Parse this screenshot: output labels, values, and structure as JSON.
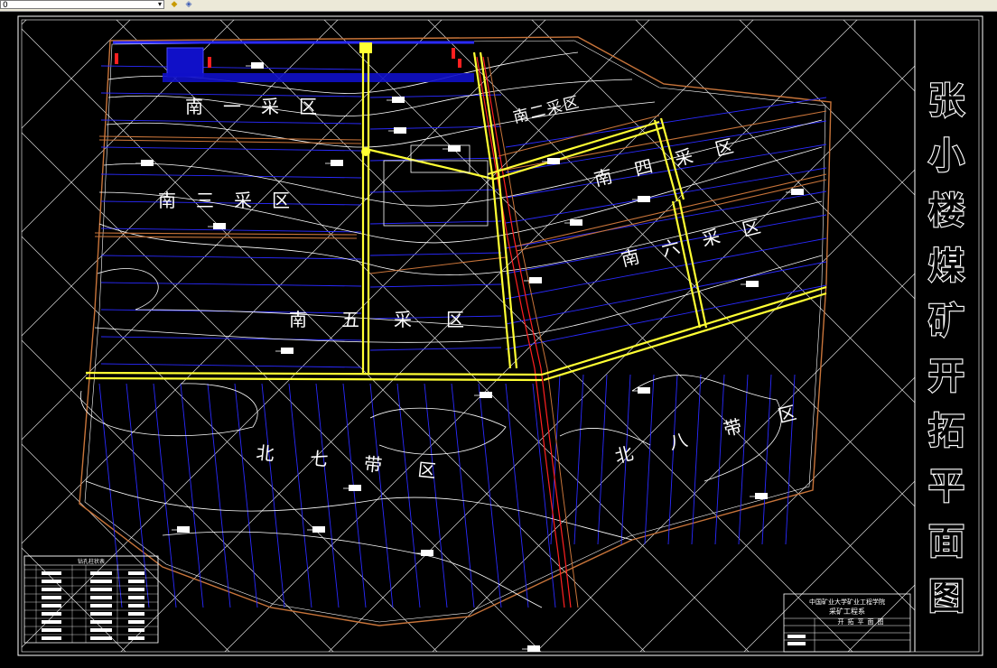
{
  "toolbar": {
    "layer_value": "0",
    "icons": [
      "layer-state-icon",
      "layer-previous-icon"
    ]
  },
  "drawing": {
    "title_vertical": [
      "张",
      "小",
      "楼",
      "煤",
      "矿",
      "开",
      "拓",
      "平",
      "面",
      "图"
    ],
    "zones": {
      "s1": "南一采区",
      "s2": "南二采区",
      "s3": "南三采区",
      "s4": "南四采区",
      "s5": "南五采区",
      "s6": "南六采区",
      "n7": "北七带区",
      "n8": "北八带区"
    },
    "title_block": {
      "university": "中国矿业大学矿业工程学院",
      "department": "采矿工程系",
      "drawing_name": "开拓平面图"
    },
    "legend_title": "钻孔柱状表"
  },
  "colors": {
    "background": "#000000",
    "frame": "#ffffff",
    "roadway": "#ffff33",
    "contour": "#ffffff",
    "seam_lines": "#2a2aff",
    "boundary": "#c8743a",
    "fault": "#ff2020"
  }
}
